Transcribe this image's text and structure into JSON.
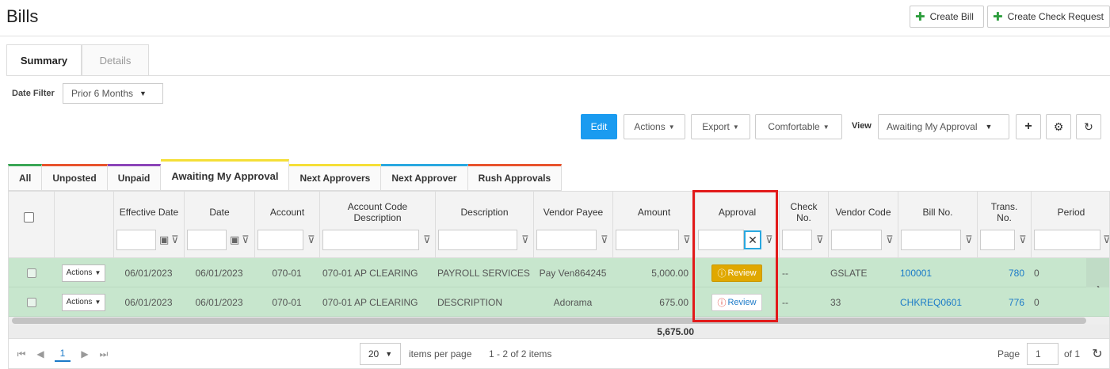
{
  "page": {
    "title": "Bills",
    "create_bill": "Create Bill",
    "create_check_request": "Create Check Request"
  },
  "tabs": [
    {
      "label": "Summary",
      "active": true
    },
    {
      "label": "Details",
      "active": false
    }
  ],
  "date_filter": {
    "label": "Date Filter",
    "value": "Prior 6 Months"
  },
  "toolbar": {
    "edit": "Edit",
    "actions": "Actions",
    "export": "Export",
    "density": "Comfortable",
    "view_label": "View",
    "view_value": "Awaiting My Approval"
  },
  "subtabs": [
    {
      "label": "All",
      "color": "#3aa655"
    },
    {
      "label": "Unposted",
      "color": "#e8532d"
    },
    {
      "label": "Unpaid",
      "color": "#8b44b8"
    },
    {
      "label": "Awaiting My Approval",
      "color": "#f5df37"
    },
    {
      "label": "Next Approvers",
      "color": "#f5df37"
    },
    {
      "label": "Next Approver",
      "color": "#29a8e0"
    },
    {
      "label": "Rush Approvals",
      "color": "#e8532d"
    }
  ],
  "grid": {
    "columns": [
      {
        "label": ""
      },
      {
        "label": ""
      },
      {
        "label": "Effective Date"
      },
      {
        "label": "Date"
      },
      {
        "label": "Account"
      },
      {
        "label": "Account Code Description"
      },
      {
        "label": "Description"
      },
      {
        "label": "Vendor Payee"
      },
      {
        "label": "Amount"
      },
      {
        "label": "Approval"
      },
      {
        "label": "Check No."
      },
      {
        "label": "Vendor Code"
      },
      {
        "label": "Bill No."
      },
      {
        "label": "Trans. No."
      },
      {
        "label": "Period"
      }
    ],
    "rows": [
      {
        "actions": "Actions",
        "effective_date": "06/01/2023",
        "date": "06/01/2023",
        "account": "070-01",
        "account_code_description": "070-01 AP CLEARING",
        "description": "PAYROLL SERVICES",
        "vendor_payee": "Pay Ven864245",
        "amount": "5,000.00",
        "approval": "Review",
        "check_no": "--",
        "vendor_code": "GSLATE",
        "bill_no": "100001",
        "trans_no": "780",
        "period": "0"
      },
      {
        "actions": "Actions",
        "effective_date": "06/01/2023",
        "date": "06/01/2023",
        "account": "070-01",
        "account_code_description": "070-01 AP CLEARING",
        "description": "DESCRIPTION",
        "vendor_payee": "Adorama",
        "amount": "675.00",
        "approval": "Review",
        "check_no": "--",
        "vendor_code": "33",
        "bill_no": "CHKREQ0601",
        "trans_no": "776",
        "period": "0"
      }
    ],
    "total_amount": "5,675.00"
  },
  "pager": {
    "current_page": "1",
    "page_size": "20",
    "items_label": "items per page",
    "range": "1 - 2 of 2 items",
    "page_label": "Page",
    "page_input": "1",
    "of_label": "of 1"
  }
}
